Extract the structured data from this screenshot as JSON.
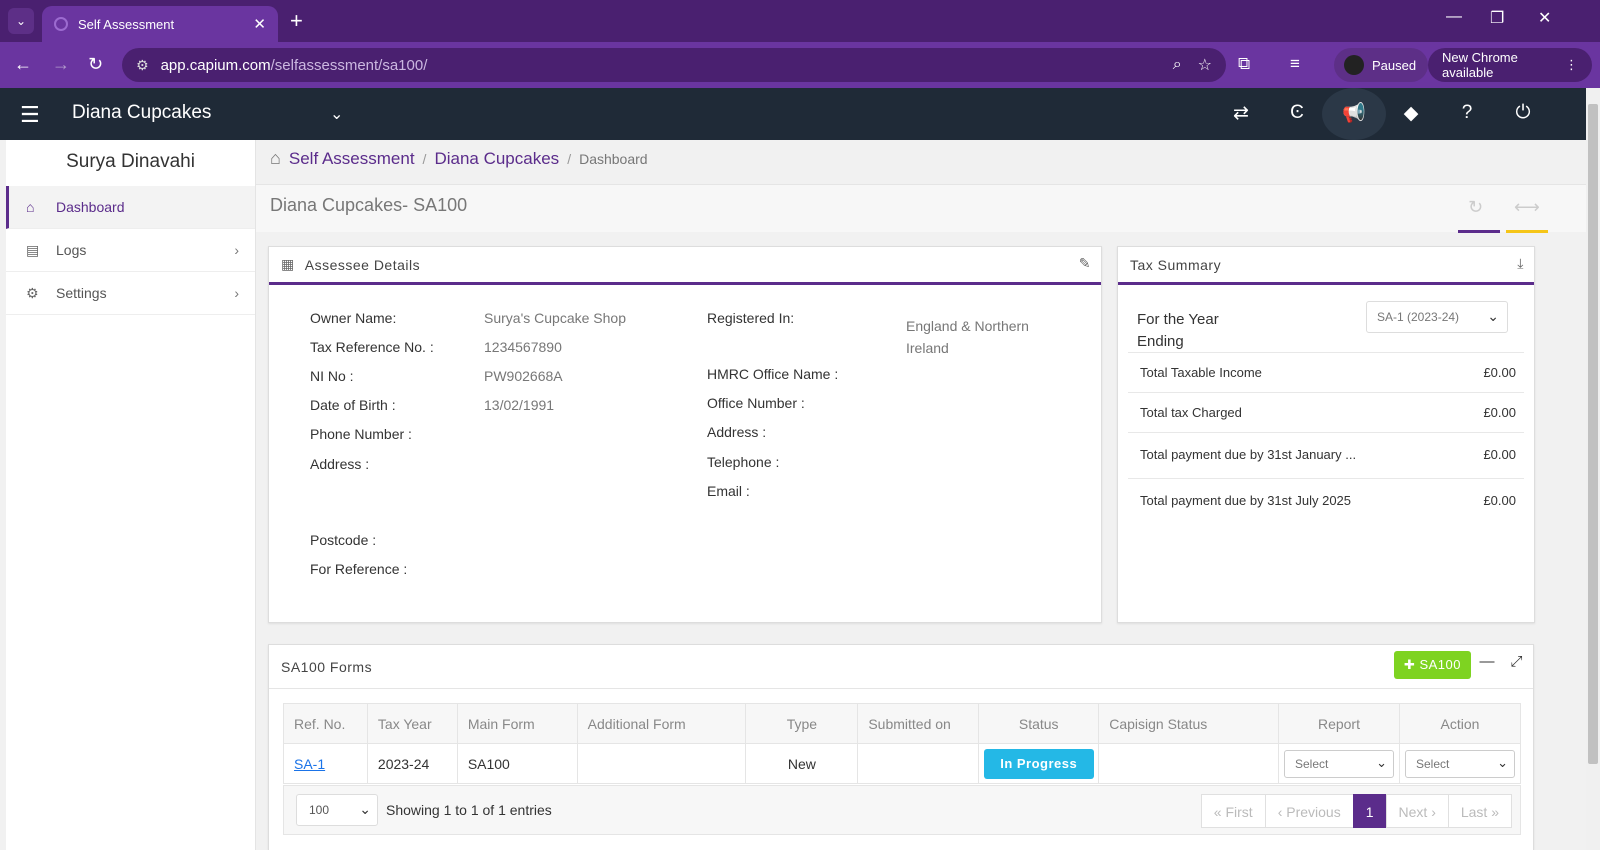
{
  "browser": {
    "tab_title": "Self Assessment",
    "url_host": "app.capium.com",
    "url_path": "/selfassessment/sa100/",
    "profile_status": "Paused",
    "update_label": "New Chrome available"
  },
  "header": {
    "client_name": "Diana Cupcakes"
  },
  "sidebar": {
    "user_name": "Surya Dinavahi",
    "items": [
      {
        "label": "Dashboard",
        "icon": "home-icon",
        "active": true
      },
      {
        "label": "Logs",
        "icon": "file-icon",
        "active": false
      },
      {
        "label": "Settings",
        "icon": "gear-icon",
        "active": false
      }
    ]
  },
  "breadcrumb": {
    "items": [
      "Self Assessment",
      "Diana Cupcakes",
      "Dashboard"
    ]
  },
  "page": {
    "title": "Diana Cupcakes- SA100"
  },
  "assessee": {
    "heading": "Assessee Details",
    "left": [
      {
        "label": "Owner Name:",
        "value": "Surya's Cupcake Shop"
      },
      {
        "label": "Tax Reference No. :",
        "value": "1234567890"
      },
      {
        "label": "NI No :",
        "value": "PW902668A"
      },
      {
        "label": "Date of Birth :",
        "value": "13/02/1991"
      },
      {
        "label": "Phone Number :",
        "value": ""
      },
      {
        "label": "Address :",
        "value": ""
      },
      {
        "label": "Postcode :",
        "value": ""
      },
      {
        "label": "For Reference :",
        "value": ""
      }
    ],
    "right": [
      {
        "label": "Registered In:",
        "value": "England & Northern Ireland"
      },
      {
        "label": "HMRC Office Name :",
        "value": ""
      },
      {
        "label": "Office Number :",
        "value": ""
      },
      {
        "label": "Address :",
        "value": ""
      },
      {
        "label": "Telephone :",
        "value": ""
      },
      {
        "label": "Email :",
        "value": ""
      }
    ]
  },
  "tax_summary": {
    "heading": "Tax Summary",
    "year_label": "For the Year Ending",
    "year_selected": "SA-1 (2023-24)",
    "rows": [
      {
        "label": "Total Taxable Income",
        "amount": "£0.00"
      },
      {
        "label": "Total tax Charged",
        "amount": "£0.00"
      },
      {
        "label": "Total payment due by 31st January ...",
        "amount": "£0.00"
      },
      {
        "label": "Total payment due by 31st July 2025",
        "amount": "£0.00"
      }
    ]
  },
  "forms": {
    "heading": "SA100 Forms",
    "add_label": "SA100",
    "columns": [
      "Ref. No.",
      "Tax Year",
      "Main Form",
      "Additional Form",
      "Type",
      "Submitted on",
      "Status",
      "Capisign Status",
      "Report",
      "Action"
    ],
    "rows": [
      {
        "ref": "SA-1",
        "tax_year": "2023-24",
        "main_form": "SA100",
        "additional_form": "",
        "type": "New",
        "submitted_on": "",
        "status": "In Progress",
        "capisign_status": "",
        "report": "Select",
        "action": "Select"
      }
    ],
    "page_size": "100",
    "showing": "Showing 1 to 1 of 1 entries",
    "pager": {
      "first": "« First",
      "prev": "‹ Previous",
      "current": "1",
      "next": "Next ›",
      "last": "Last »"
    }
  },
  "colors": {
    "brand_purple": "#5b2c8b",
    "header_dark": "#1f2a37",
    "status_blue": "#24b8e6",
    "add_green": "#7ed321"
  }
}
